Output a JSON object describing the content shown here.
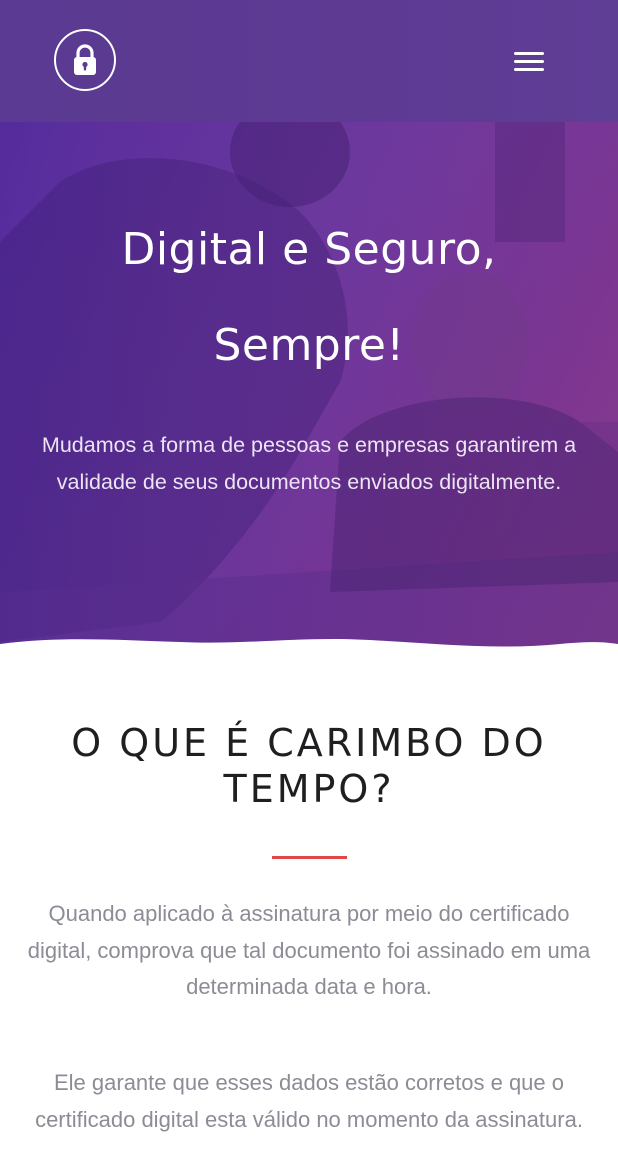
{
  "header": {
    "logo_icon": "lock-icon",
    "menu_icon": "hamburger-menu-icon"
  },
  "hero": {
    "title_line1": "Digital e Seguro,",
    "title_line2": "Sempre!",
    "subtitle": "Mudamos a forma de pessoas e empresas garantirem a validade de seus documentos enviados digitalmente."
  },
  "section": {
    "title": "O QUE É CARIMBO DO TEMPO?",
    "paragraph1": "Quando aplicado à assinatura por meio do certificado digital, comprova que tal documento foi assinado em uma determinada data e hora.",
    "paragraph2": "Ele garante que esses dados estão corretos e que o certificado digital esta válido no momento da assinatura."
  },
  "colors": {
    "header_bg": "#5e3a93",
    "hero_gradient_start": "#5a2fa3",
    "hero_gradient_end": "#8a3b8a",
    "accent_divider": "#e04848",
    "title_text": "#1f1f22",
    "body_text": "#8c8c96"
  }
}
